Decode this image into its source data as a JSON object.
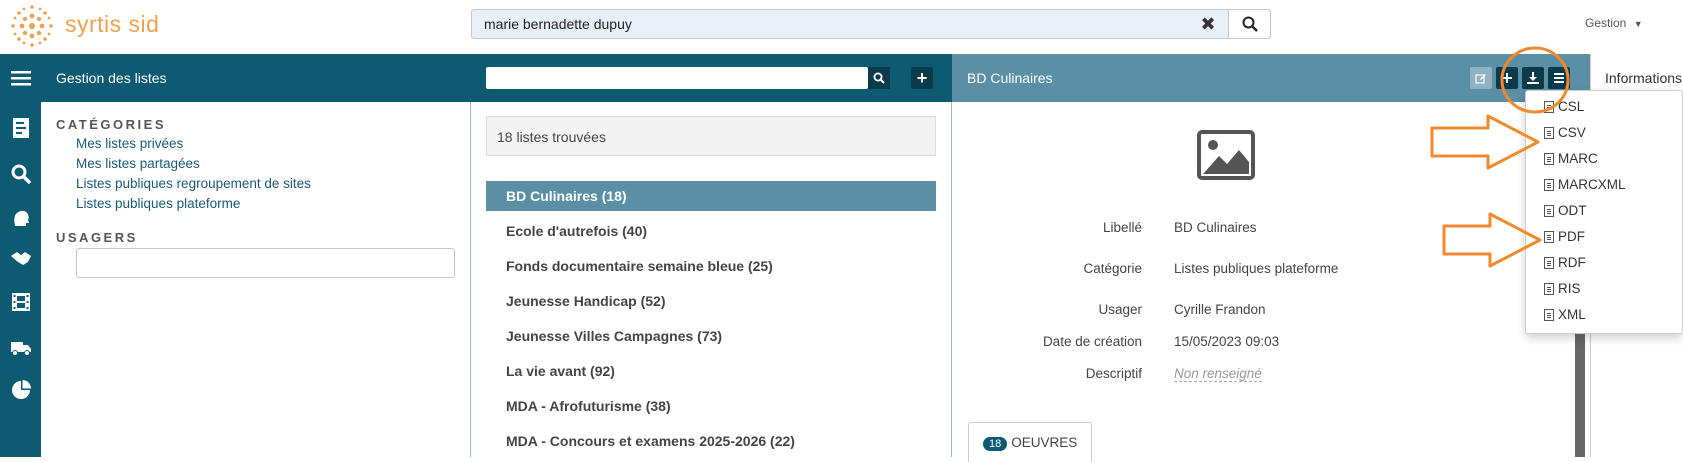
{
  "app": {
    "logo_text": "syrtis sid"
  },
  "topbar": {
    "search_value": "marie bernadette dupuy",
    "gestion_label": "Gestion"
  },
  "left": {
    "title": "Gestion des listes",
    "categories_title": "CATÉGORIES",
    "categories": [
      "Mes listes privées",
      "Mes listes partagées",
      "Listes publiques regroupement de sites",
      "Listes publiques plateforme"
    ],
    "usagers_title": "USAGERS"
  },
  "middle": {
    "found_label": "18 listes trouvées",
    "items": [
      "BD Culinaires (18)",
      "Ecole d'autrefois (40)",
      "Fonds documentaire semaine bleue (25)",
      "Jeunesse Handicap (52)",
      "Jeunesse Villes Campagnes (73)",
      "La vie avant (92)",
      "MDA - Afrofuturisme (38)",
      "MDA - Concours et examens 2025-2026 (22)"
    ]
  },
  "detail": {
    "title": "BD Culinaires",
    "fields": [
      {
        "label": "Libellé",
        "value": "BD Culinaires"
      },
      {
        "label": "Catégorie",
        "value": "Listes publiques plateforme"
      },
      {
        "label": "Usager",
        "value": "Cyrille Frandon"
      },
      {
        "label": "Date de création",
        "value": "15/05/2023 09:03"
      },
      {
        "label": "Descriptif",
        "value": "Non renseigné"
      }
    ],
    "oeuvres_count": "18",
    "oeuvres_label": "OEUVRES"
  },
  "info_tab": "Informations",
  "export_menu": [
    "CSL",
    "CSV",
    "MARC",
    "MARCXML",
    "ODT",
    "PDF",
    "RDF",
    "RIS",
    "XML"
  ],
  "colors": {
    "header_dark": "#0d5a73",
    "header_light": "#5b8fa6",
    "annotation": "#f08a2c",
    "logo": "#f0a050"
  }
}
